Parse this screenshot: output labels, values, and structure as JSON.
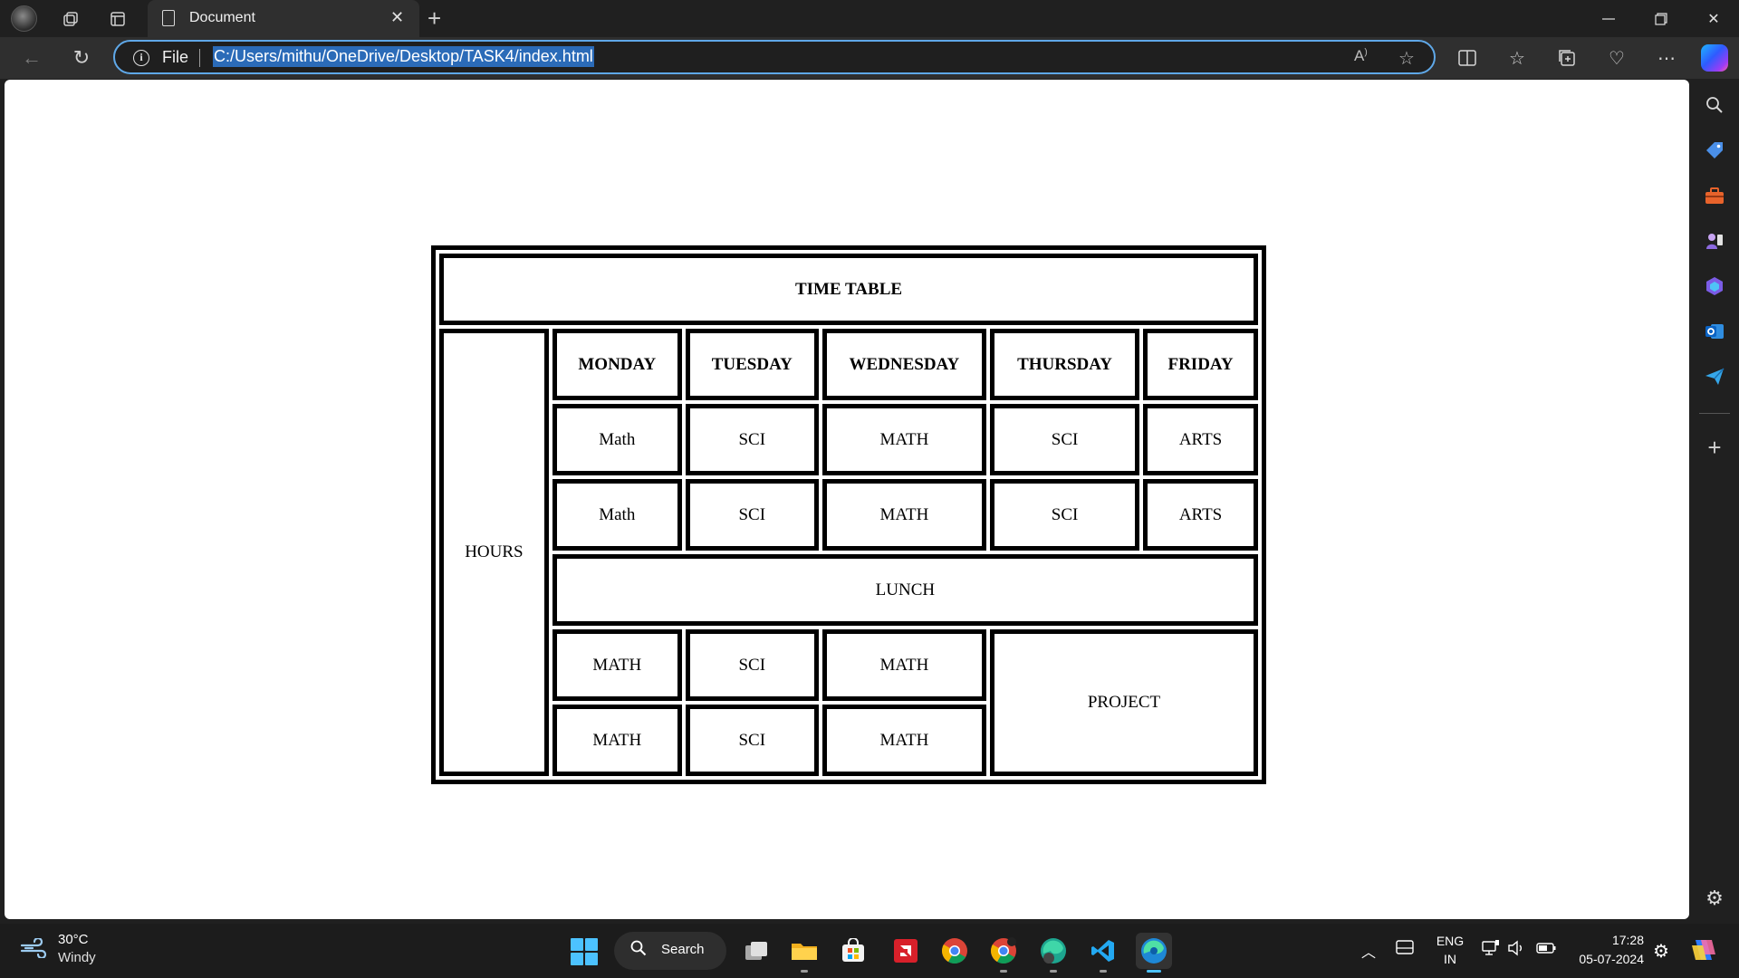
{
  "browser": {
    "tab_title": "Document",
    "address": {
      "scheme_label": "File",
      "url": "C:/Users/mithu/OneDrive/Desktop/TASK4/index.html"
    },
    "icons": [
      "workspaces-icon",
      "tab-actions-icon",
      "back-icon",
      "refresh-icon",
      "read-aloud-icon",
      "favorite-star-icon",
      "split-screen-icon",
      "favorites-icon",
      "collections-icon",
      "browser-essentials-icon",
      "more-icon",
      "copilot-icon"
    ]
  },
  "timetable": {
    "title": "TIME TABLE",
    "hours_label": "HOURS",
    "days": [
      "MONDAY",
      "TUESDAY",
      "WEDNESDAY",
      "THURSDAY",
      "FRIDAY"
    ],
    "row1": [
      "Math",
      "SCI",
      "MATH",
      "SCI",
      "ARTS"
    ],
    "row2": [
      "Math",
      "SCI",
      "MATH",
      "SCI",
      "ARTS"
    ],
    "lunch": "LUNCH",
    "row3": [
      "MATH",
      "SCI",
      "MATH"
    ],
    "row4": [
      "MATH",
      "SCI",
      "MATH"
    ],
    "project": "PROJECT"
  },
  "sidebar": {
    "icons": [
      "search-icon",
      "shopping-tag-icon",
      "tools-icon",
      "games-icon",
      "copilot-sidebar-icon",
      "outlook-icon",
      "send-icon",
      "add-icon",
      "settings-icon"
    ]
  },
  "taskbar": {
    "weather_temp": "30°C",
    "weather_desc": "Windy",
    "search_label": "Search",
    "lang_line1": "ENG",
    "lang_line2": "IN",
    "time": "17:28",
    "date": "05-07-2024",
    "colors": {
      "start": "#4cc2ff",
      "accent_underline": "#4cc2ff"
    }
  }
}
